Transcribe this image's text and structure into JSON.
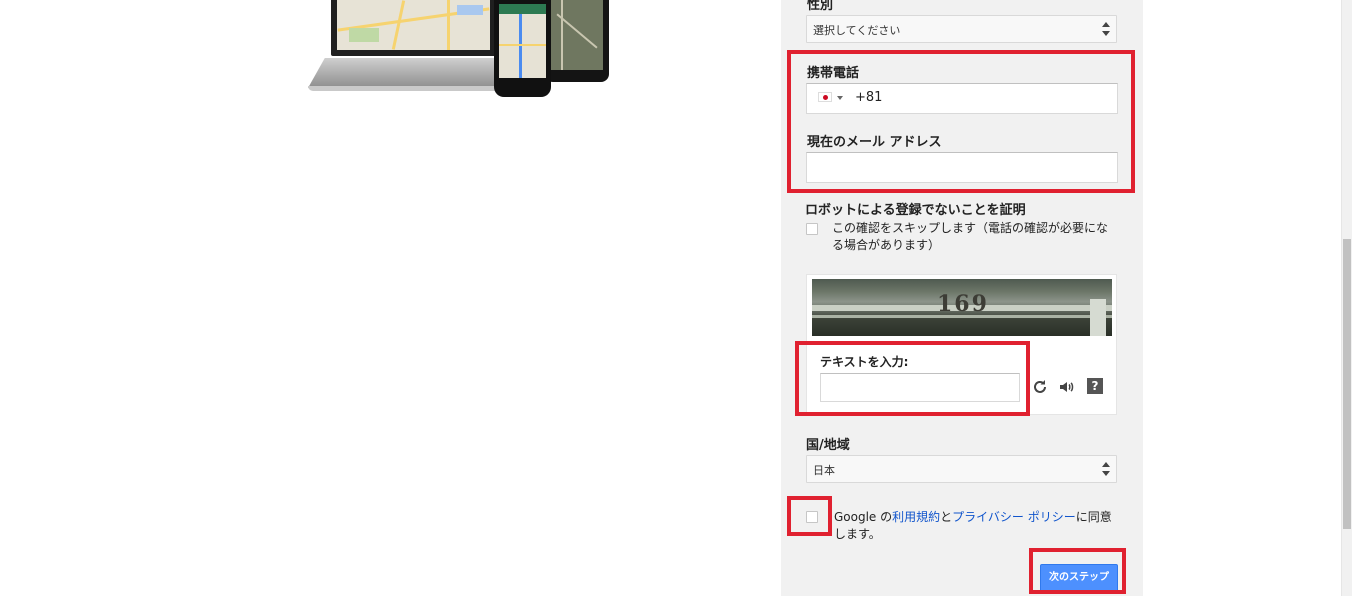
{
  "gender": {
    "label": "性別",
    "selected": "選択してください"
  },
  "mobile": {
    "label": "携帯電話",
    "country_code": "+81",
    "flag_icon": "japan-flag-icon"
  },
  "email": {
    "label": "現在のメール アドレス",
    "value": ""
  },
  "robot": {
    "heading": "ロボットによる登録でないことを証明",
    "skip_label_line1": "この確認をスキップします（電話の確認が必要にな",
    "skip_label_line2": "る場合があります）"
  },
  "captcha": {
    "image_text": "169",
    "input_label": "テキストを入力:",
    "input_value": "",
    "refresh_icon": "refresh-icon",
    "audio_icon": "speaker-icon",
    "help_icon": "help-icon"
  },
  "country": {
    "label": "国/地域",
    "selected": "日本"
  },
  "terms": {
    "prefix": "Google の",
    "tos_link": "利用規約",
    "and": "と",
    "privacy_link": "プライバシー ポリシー",
    "suffix": "に同意",
    "line2": "します。"
  },
  "next_button": "次のステップ",
  "colors": {
    "highlight": "#e02130",
    "primary_button": "#4d90fe",
    "link": "#1155cc",
    "panel_background": "#f1f1f1"
  }
}
